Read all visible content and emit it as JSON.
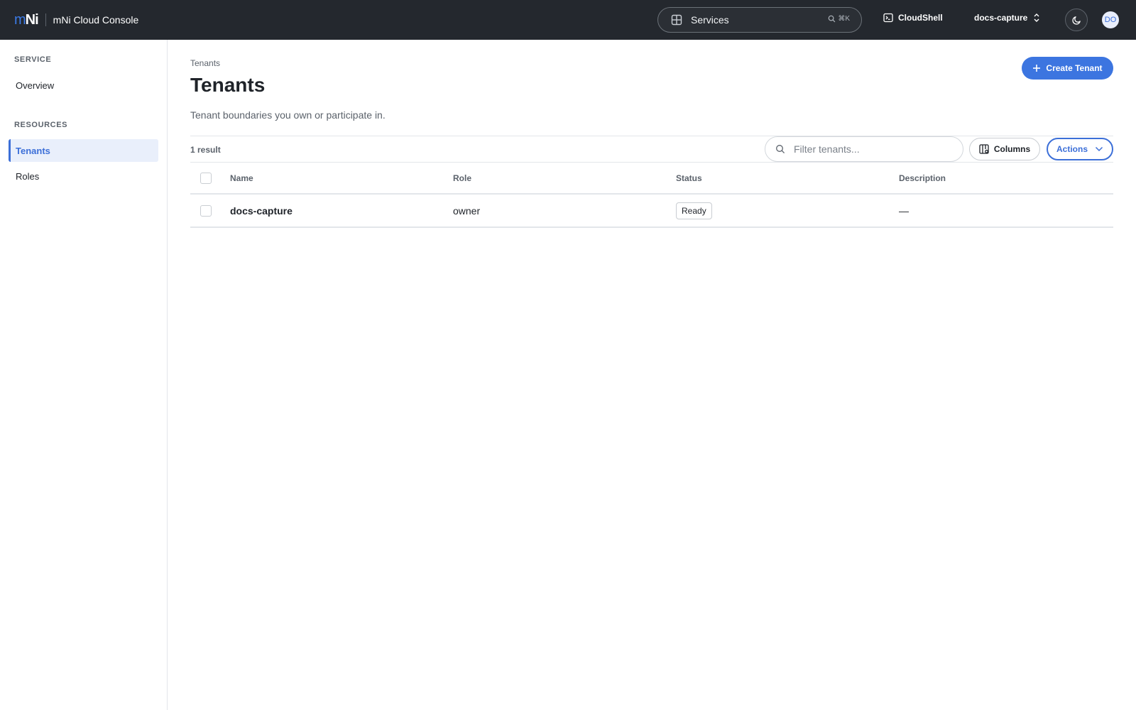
{
  "app": {
    "logo_m": "m",
    "logo_ni": "Ni",
    "title": "mNi Cloud Console"
  },
  "topbar": {
    "services_label": "Services",
    "search_shortcut": "⌘K",
    "cloudshell_label": "CloudShell",
    "project_label": "docs-capture",
    "avatar_initials": "DO"
  },
  "sidebar": {
    "sections": [
      {
        "heading": "SERVICE",
        "items": [
          {
            "label": "Overview",
            "active": false
          }
        ]
      },
      {
        "heading": "RESOURCES",
        "items": [
          {
            "label": "Tenants",
            "active": true
          },
          {
            "label": "Roles",
            "active": false
          }
        ]
      }
    ]
  },
  "main": {
    "breadcrumb": "Tenants",
    "title": "Tenants",
    "description": "Tenant boundaries you own or participate in.",
    "create_button": "Create Tenant",
    "result_count": "1 result",
    "filter_placeholder": "Filter tenants...",
    "columns_button": "Columns",
    "actions_button": "Actions"
  },
  "table": {
    "columns": [
      "Name",
      "Role",
      "Status",
      "Description"
    ],
    "rows": [
      {
        "name": "docs-capture",
        "role": "owner",
        "status": "Ready",
        "description": "—"
      }
    ]
  },
  "colors": {
    "topbar_bg": "#24282e",
    "accent": "#3c75e0",
    "active_nav_bg": "#e9effb"
  },
  "icons": {
    "services": "grid-icon",
    "search": "search-icon",
    "cloudshell": "terminal-icon",
    "project": "chevron-updown-icon",
    "theme": "moon-icon",
    "create": "plus-icon",
    "columns": "columns-icon",
    "actions": "chevron-down-icon"
  }
}
